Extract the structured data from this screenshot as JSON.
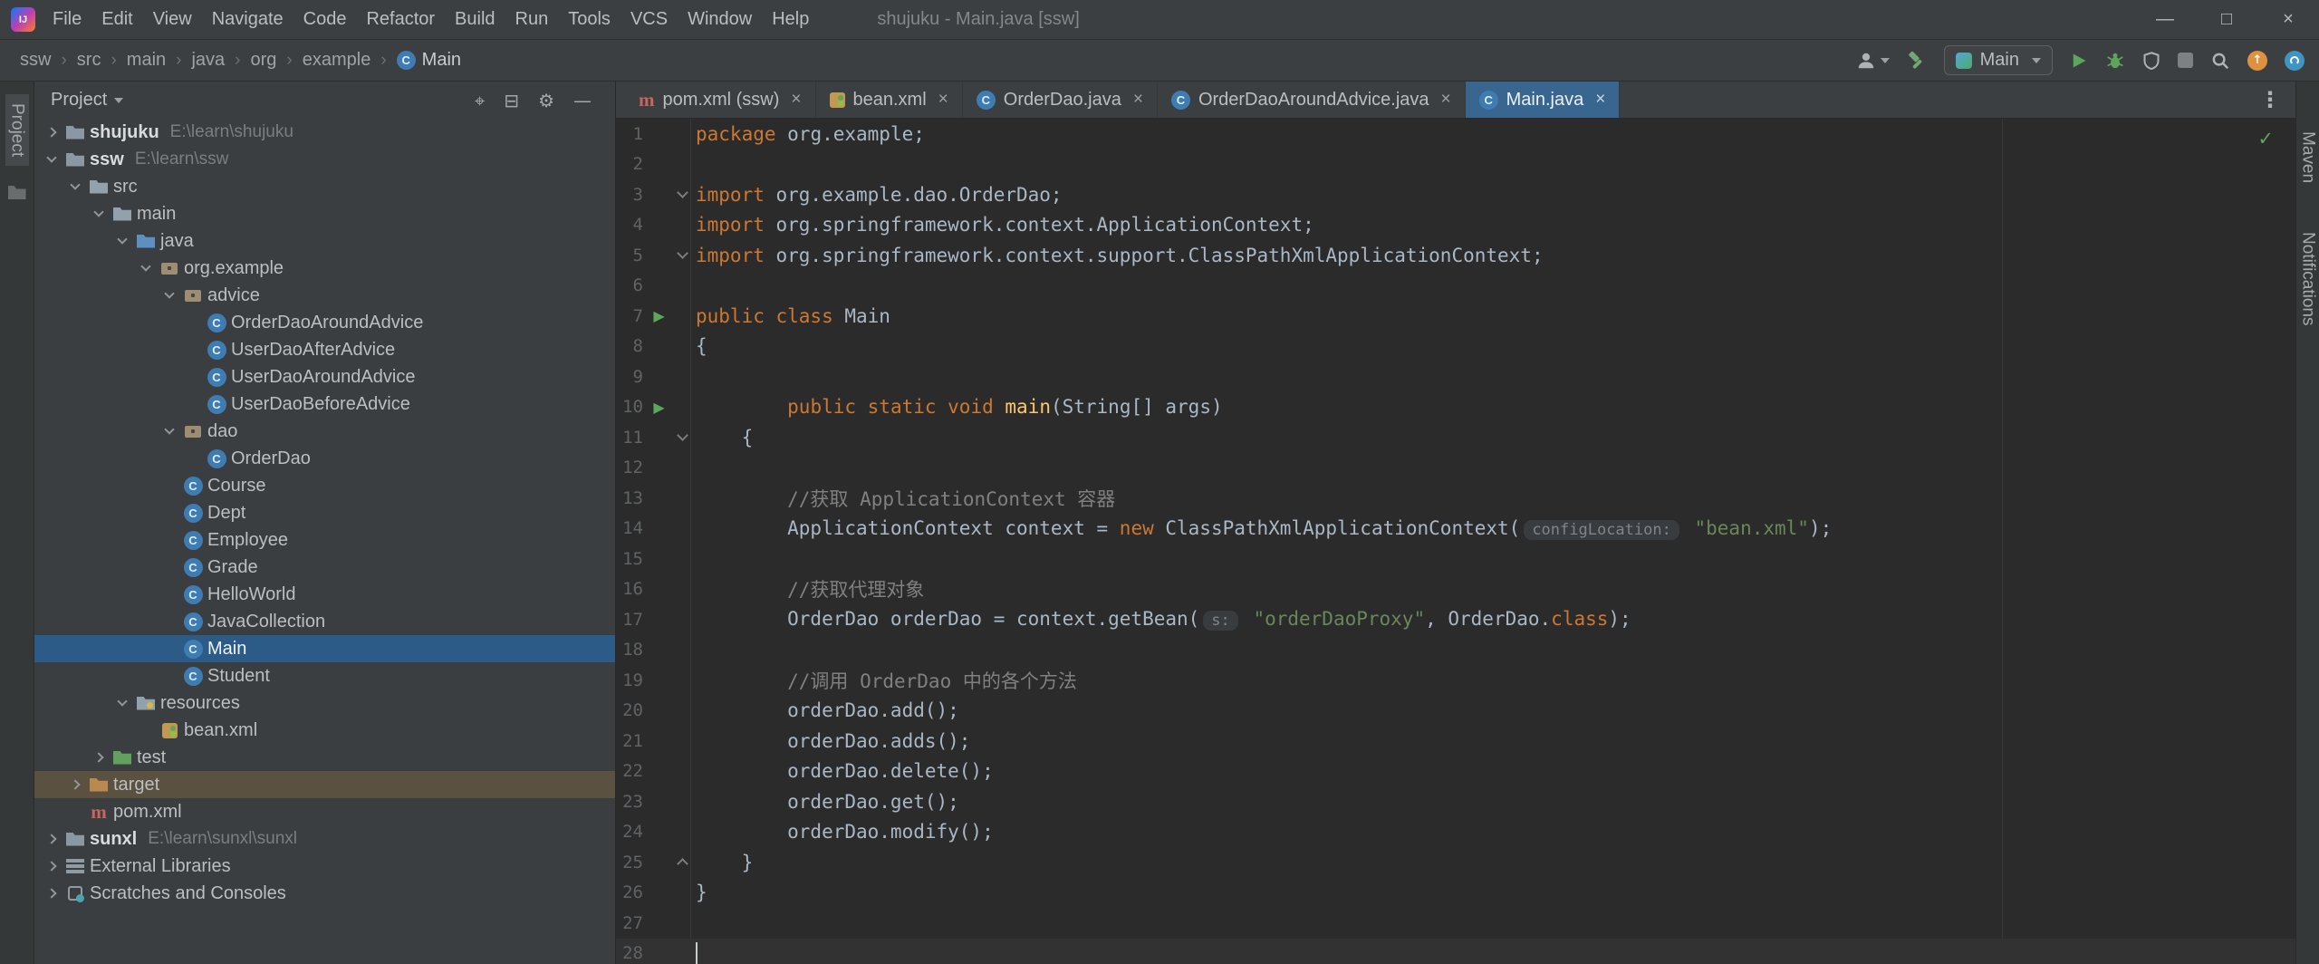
{
  "window": {
    "title": "shujuku - Main.java [ssw]",
    "controls": {
      "minimize": "—",
      "maximize": "□",
      "close": "×"
    }
  },
  "menubar": {
    "items": [
      "File",
      "Edit",
      "View",
      "Navigate",
      "Code",
      "Refactor",
      "Build",
      "Run",
      "Tools",
      "VCS",
      "Window",
      "Help"
    ]
  },
  "nav_bar": {
    "breadcrumbs": [
      {
        "label": "ssw"
      },
      {
        "label": "src"
      },
      {
        "label": "main"
      },
      {
        "label": "java"
      },
      {
        "label": "org"
      },
      {
        "label": "example"
      },
      {
        "label": "Main",
        "icon": "class"
      }
    ],
    "run_config": "Main"
  },
  "tool_stripes": {
    "left": [
      "Project"
    ],
    "right": [
      "Maven",
      "Notifications"
    ]
  },
  "project_panel": {
    "header": {
      "title": "Project"
    },
    "tree": [
      {
        "ind": 0,
        "ch": "closed",
        "icon": "project",
        "label": "shujuku",
        "path": "E:\\learn\\shujuku",
        "bold": true
      },
      {
        "ind": 0,
        "ch": "open",
        "icon": "project",
        "label": "ssw",
        "path": "E:\\learn\\ssw",
        "bold": true
      },
      {
        "ind": 1,
        "ch": "open",
        "icon": "folder",
        "label": "src"
      },
      {
        "ind": 2,
        "ch": "open",
        "icon": "folder",
        "label": "main"
      },
      {
        "ind": 3,
        "ch": "open",
        "icon": "folder-java",
        "label": "java"
      },
      {
        "ind": 4,
        "ch": "open",
        "icon": "package",
        "label": "org.example"
      },
      {
        "ind": 5,
        "ch": "open",
        "icon": "package",
        "label": "advice"
      },
      {
        "ind": 6,
        "ch": "none",
        "icon": "class",
        "label": "OrderDaoAroundAdvice"
      },
      {
        "ind": 6,
        "ch": "none",
        "icon": "class",
        "label": "UserDaoAfterAdvice"
      },
      {
        "ind": 6,
        "ch": "none",
        "icon": "class",
        "label": "UserDaoAroundAdvice"
      },
      {
        "ind": 6,
        "ch": "none",
        "icon": "class",
        "label": "UserDaoBeforeAdvice"
      },
      {
        "ind": 5,
        "ch": "open",
        "icon": "package",
        "label": "dao"
      },
      {
        "ind": 6,
        "ch": "none",
        "icon": "class",
        "label": "OrderDao"
      },
      {
        "ind": 5,
        "ch": "none",
        "icon": "class",
        "label": "Course"
      },
      {
        "ind": 5,
        "ch": "none",
        "icon": "class",
        "label": "Dept"
      },
      {
        "ind": 5,
        "ch": "none",
        "icon": "class",
        "label": "Employee"
      },
      {
        "ind": 5,
        "ch": "none",
        "icon": "class",
        "label": "Grade"
      },
      {
        "ind": 5,
        "ch": "none",
        "icon": "class",
        "label": "HelloWorld"
      },
      {
        "ind": 5,
        "ch": "none",
        "icon": "class",
        "label": "JavaCollection"
      },
      {
        "ind": 5,
        "ch": "none",
        "icon": "class",
        "label": "Main",
        "selected": true
      },
      {
        "ind": 5,
        "ch": "none",
        "icon": "class",
        "label": "Student"
      },
      {
        "ind": 3,
        "ch": "open",
        "icon": "folder-resources",
        "label": "resources"
      },
      {
        "ind": 4,
        "ch": "none",
        "icon": "spring",
        "label": "bean.xml"
      },
      {
        "ind": 2,
        "ch": "closed",
        "icon": "folder-test",
        "label": "test"
      },
      {
        "ind": 1,
        "ch": "closed",
        "icon": "folder-excluded",
        "label": "target",
        "excluded": true
      },
      {
        "ind": 1,
        "ch": "none",
        "icon": "maven",
        "label": "pom.xml"
      },
      {
        "ind": 0,
        "ch": "closed",
        "icon": "project",
        "label": "sunxl",
        "path": "E:\\learn\\sunxl\\sunxl",
        "bold": true
      },
      {
        "ind": 0,
        "ch": "closed",
        "icon": "libraries",
        "label": "External Libraries"
      },
      {
        "ind": 0,
        "ch": "closed",
        "icon": "scratches",
        "label": "Scratches and Consoles"
      }
    ]
  },
  "editor": {
    "tabs": [
      {
        "label": "pom.xml (ssw)",
        "icon": "maven"
      },
      {
        "label": "bean.xml",
        "icon": "spring"
      },
      {
        "label": "OrderDao.java",
        "icon": "class"
      },
      {
        "label": "OrderDaoAroundAdvice.java",
        "icon": "class"
      },
      {
        "label": "Main.java",
        "icon": "class",
        "active": true
      }
    ],
    "colors": {
      "keyword": "#CC7832",
      "string": "#6A8759",
      "comment": "#808080",
      "text": "#A9B7C6",
      "method": "#FFC66D",
      "line_number": "#606366",
      "background": "#2B2B2B",
      "selection": "#2D5B88",
      "active_tab": "#39668F"
    },
    "inspection_status": "ok",
    "caret_line": 28,
    "lines": [
      {
        "n": 1,
        "seg": [
          [
            "k",
            "package"
          ],
          [
            "d",
            " org.example;"
          ]
        ]
      },
      {
        "n": 2,
        "seg": []
      },
      {
        "n": 3,
        "fold": "down",
        "seg": [
          [
            "k",
            "import"
          ],
          [
            "d",
            " org.example.dao.OrderDao;"
          ]
        ]
      },
      {
        "n": 4,
        "seg": [
          [
            "k",
            "import"
          ],
          [
            "d",
            " org.springframework.context.ApplicationContext;"
          ]
        ]
      },
      {
        "n": 5,
        "fold": "down",
        "seg": [
          [
            "k",
            "import"
          ],
          [
            "d",
            " org.springframework.context.support.ClassPathXmlApplicationContext;"
          ]
        ]
      },
      {
        "n": 6,
        "seg": []
      },
      {
        "n": 7,
        "run": true,
        "seg": [
          [
            "k",
            "public class"
          ],
          [
            "d",
            " Main"
          ]
        ]
      },
      {
        "n": 8,
        "seg": [
          [
            "d",
            "{"
          ]
        ]
      },
      {
        "n": 9,
        "seg": []
      },
      {
        "n": 10,
        "run": true,
        "seg": [
          [
            "d",
            "        "
          ],
          [
            "k",
            "public static void"
          ],
          [
            "d",
            " "
          ],
          [
            "f",
            "main"
          ],
          [
            "d",
            "(String[] args)"
          ]
        ]
      },
      {
        "n": 11,
        "fold": "down",
        "seg": [
          [
            "d",
            "    {"
          ]
        ]
      },
      {
        "n": 12,
        "seg": []
      },
      {
        "n": 13,
        "seg": [
          [
            "c",
            "        //获取 ApplicationContext 容器"
          ]
        ]
      },
      {
        "n": 14,
        "seg": [
          [
            "d",
            "        ApplicationContext context = "
          ],
          [
            "k",
            "new"
          ],
          [
            "d",
            " ClassPathXmlApplicationContext("
          ],
          [
            "i",
            "configLocation:"
          ],
          [
            "d",
            " "
          ],
          [
            "s",
            "\"bean.xml\""
          ],
          [
            "d",
            ");"
          ]
        ]
      },
      {
        "n": 15,
        "seg": []
      },
      {
        "n": 16,
        "seg": [
          [
            "c",
            "        //获取代理对象"
          ]
        ]
      },
      {
        "n": 17,
        "seg": [
          [
            "d",
            "        OrderDao orderDao = context.getBean("
          ],
          [
            "i",
            "s:"
          ],
          [
            "d",
            " "
          ],
          [
            "s",
            "\"orderDaoProxy\""
          ],
          [
            "d",
            ", OrderDao."
          ],
          [
            "k",
            "class"
          ],
          [
            "d",
            ");"
          ]
        ]
      },
      {
        "n": 18,
        "seg": []
      },
      {
        "n": 19,
        "seg": [
          [
            "c",
            "        //调用 OrderDao 中的各个方法"
          ]
        ]
      },
      {
        "n": 20,
        "seg": [
          [
            "d",
            "        orderDao.add();"
          ]
        ]
      },
      {
        "n": 21,
        "seg": [
          [
            "d",
            "        orderDao.adds();"
          ]
        ]
      },
      {
        "n": 22,
        "seg": [
          [
            "d",
            "        orderDao.delete();"
          ]
        ]
      },
      {
        "n": 23,
        "seg": [
          [
            "d",
            "        orderDao.get();"
          ]
        ]
      },
      {
        "n": 24,
        "seg": [
          [
            "d",
            "        orderDao.modify();"
          ]
        ]
      },
      {
        "n": 25,
        "fold": "up",
        "seg": [
          [
            "d",
            "    }"
          ]
        ]
      },
      {
        "n": 26,
        "seg": [
          [
            "d",
            "}"
          ]
        ]
      },
      {
        "n": 27,
        "seg": []
      },
      {
        "n": 28,
        "seg": []
      }
    ]
  }
}
